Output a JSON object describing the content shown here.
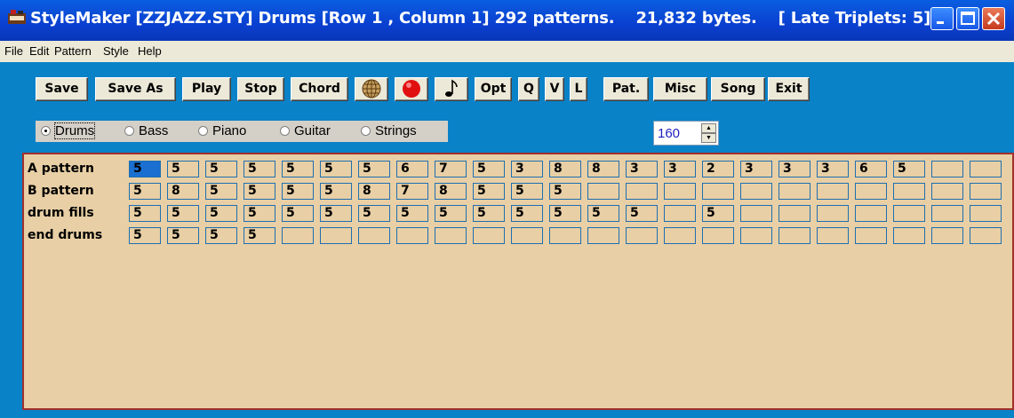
{
  "window": {
    "title_parts": [
      "StyleMaker [ZZJAZZ.STY] Drums  [Row 1 , Column 1]  292 patterns.",
      "21,832 bytes.",
      "[ Late Triplets: 5]"
    ],
    "app_icon": "piano-icon",
    "controls": [
      "minimize-icon",
      "maximize-icon",
      "close-icon"
    ]
  },
  "menu": [
    "File",
    "Edit",
    "Pattern",
    "Style",
    "Help"
  ],
  "toolbar": {
    "buttons": [
      "Save",
      "Save As",
      "Play",
      "Stop",
      "Chord",
      "",
      "",
      "",
      "Opt",
      "Q",
      "V",
      "L",
      "Pat.",
      "Misc",
      "Song",
      "Exit"
    ],
    "icons": [
      "globe-icon",
      "record-icon",
      "music-note-icon"
    ]
  },
  "instruments": {
    "options": [
      "Drums",
      "Bass",
      "Piano",
      "Guitar",
      "Strings"
    ],
    "selected": "Drums"
  },
  "tempo": {
    "value": "160"
  },
  "patterns": {
    "rows": [
      {
        "label": "A pattern",
        "cells": [
          "5",
          "5",
          "5",
          "5",
          "5",
          "5",
          "5",
          "6",
          "7",
          "5",
          "3",
          "8",
          "8",
          "3",
          "3",
          "2",
          "3",
          "3",
          "3",
          "6",
          "5",
          "",
          ""
        ]
      },
      {
        "label": "B pattern",
        "cells": [
          "5",
          "8",
          "5",
          "5",
          "5",
          "5",
          "8",
          "7",
          "8",
          "5",
          "5",
          "5",
          "",
          "",
          "",
          "",
          "",
          "",
          "",
          "",
          "",
          "",
          ""
        ]
      },
      {
        "label": "drum fills",
        "cells": [
          "5",
          "5",
          "5",
          "5",
          "5",
          "5",
          "5",
          "5",
          "5",
          "5",
          "5",
          "5",
          "5",
          "5",
          "",
          "5",
          "",
          "",
          "",
          "",
          "",
          "",
          ""
        ]
      },
      {
        "label": "end drums",
        "cells": [
          "5",
          "5",
          "5",
          "5",
          "",
          "",
          "",
          "",
          "",
          "",
          "",
          "",
          "",
          "",
          "",
          "",
          "",
          "",
          "",
          "",
          "",
          "",
          ""
        ]
      }
    ],
    "active_cell": [
      0,
      0
    ]
  }
}
